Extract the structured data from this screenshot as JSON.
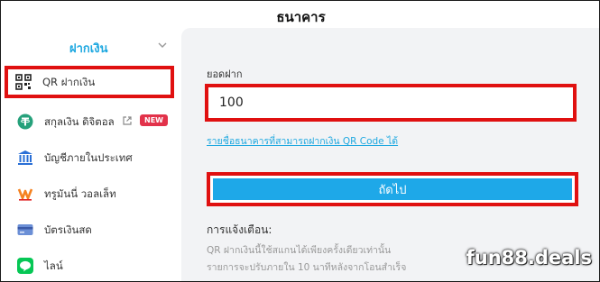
{
  "header": {
    "title": "ธนาคาร"
  },
  "sidebar": {
    "section_label": "ฝากเงิน",
    "items": [
      {
        "label": "QR ฝากเงิน",
        "icon": "qr-code-icon"
      },
      {
        "label": "สกุลเงิน ดิจิตอล",
        "icon": "tether-icon",
        "badge": "NEW"
      },
      {
        "label": "บัญชีภายในประเทศ",
        "icon": "bank-icon"
      },
      {
        "label": "ทรูมันนี่ วอลเล็ท",
        "icon": "truemoney-icon"
      },
      {
        "label": "บัตรเงินสด",
        "icon": "card-icon"
      },
      {
        "label": "ไลน์",
        "icon": "line-icon"
      }
    ]
  },
  "form": {
    "amount_label": "ยอดฝาก",
    "amount_value": "100",
    "bank_list_link": "รายชื่อธนาคารที่สามารถฝากเงิน QR Code ได้",
    "next_button": "ถัดไป"
  },
  "notice": {
    "title": "การแจ้งเตือน:",
    "lines": [
      "QR ฝากเงินนี้ใช้สแกนได้เพียงครั้งเดียวเท่านั้น",
      "รายการจะปรับภายใน 10 นาทีหลังจากโอนสำเร็จ"
    ]
  },
  "watermark": "fun88.deals",
  "colors": {
    "accent": "#1ea8e8",
    "highlight": "#e01010",
    "badge": "#e2324a"
  }
}
